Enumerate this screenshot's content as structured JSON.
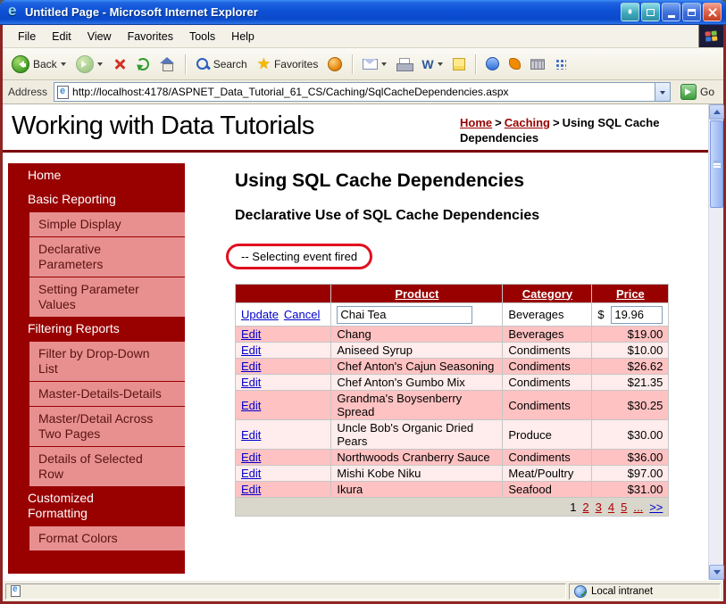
{
  "window": {
    "title": "Untitled Page - Microsoft Internet Explorer"
  },
  "menu": {
    "items": [
      "File",
      "Edit",
      "View",
      "Favorites",
      "Tools",
      "Help"
    ]
  },
  "toolbar": {
    "back_label": "Back",
    "search_label": "Search",
    "favorites_label": "Favorites"
  },
  "address": {
    "label": "Address",
    "url": "http://localhost:4178/ASPNET_Data_Tutorial_61_CS/Caching/SqlCacheDependencies.aspx",
    "go_label": "Go"
  },
  "header": {
    "site_title": "Working with Data Tutorials",
    "breadcrumb": {
      "home": "Home",
      "separator": ">",
      "caching": "Caching",
      "current": "Using SQL Cache Dependencies"
    }
  },
  "sidebar": {
    "items": [
      {
        "label": "Home",
        "type": "section"
      },
      {
        "label": "Basic Reporting",
        "type": "section"
      },
      {
        "label": "Simple Display",
        "type": "child"
      },
      {
        "label": "Declarative Parameters",
        "type": "child"
      },
      {
        "label": "Setting Parameter Values",
        "type": "child"
      },
      {
        "label": "Filtering Reports",
        "type": "section"
      },
      {
        "label": "Filter by Drop-Down List",
        "type": "child"
      },
      {
        "label": "Master-Details-Details",
        "type": "child"
      },
      {
        "label": "Master/Detail Across Two Pages",
        "type": "child"
      },
      {
        "label": "Details of Selected Row",
        "type": "child"
      },
      {
        "label": "Customized Formatting",
        "type": "section"
      },
      {
        "label": "Format Colors",
        "type": "child"
      }
    ]
  },
  "main": {
    "page_title": "Using SQL Cache Dependencies",
    "section_title": "Declarative Use of SQL Cache Dependencies",
    "annotation": "-- Selecting event fired"
  },
  "table": {
    "headers": {
      "product": "Product",
      "category": "Category",
      "price": "Price"
    },
    "edit_label": "Edit",
    "edit_row": {
      "update_label": "Update",
      "cancel_label": "Cancel",
      "product_value": "Chai Tea",
      "category": "Beverages",
      "currency": "$",
      "price_value": "19.96"
    },
    "rows": [
      {
        "product": "Chang",
        "category": "Beverages",
        "price": "$19.00"
      },
      {
        "product": "Aniseed Syrup",
        "category": "Condiments",
        "price": "$10.00"
      },
      {
        "product": "Chef Anton's Cajun Seasoning",
        "category": "Condiments",
        "price": "$26.62"
      },
      {
        "product": "Chef Anton's Gumbo Mix",
        "category": "Condiments",
        "price": "$21.35"
      },
      {
        "product": "Grandma's Boysenberry Spread",
        "category": "Condiments",
        "price": "$30.25"
      },
      {
        "product": "Uncle Bob's Organic Dried Pears",
        "category": "Produce",
        "price": "$30.00"
      },
      {
        "product": "Northwoods Cranberry Sauce",
        "category": "Condiments",
        "price": "$36.00"
      },
      {
        "product": "Mishi Kobe Niku",
        "category": "Meat/Poultry",
        "price": "$97.00"
      },
      {
        "product": "Ikura",
        "category": "Seafood",
        "price": "$31.00"
      }
    ],
    "pager": {
      "current": "1",
      "links": [
        "2",
        "3",
        "4",
        "5",
        "...",
        ">>"
      ]
    }
  },
  "status": {
    "zone_label": "Local intranet"
  },
  "colors": {
    "titlebar_blue": "#0D50D6",
    "chrome_border_maroon": "#8E2424",
    "accent_maroon": "#990000",
    "sidebar_child_pink": "#E89090",
    "row_pink": "#FFC2C2",
    "row_light_pink": "#FFECEC",
    "link_blue": "#0000CC",
    "link_visited_red": "#B00000",
    "annotation_red": "#E01020"
  }
}
